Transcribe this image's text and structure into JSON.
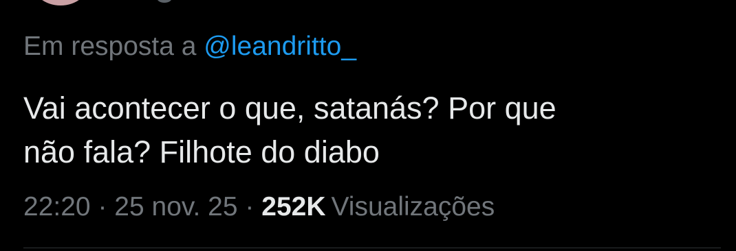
{
  "reply": {
    "prefix": "Em resposta a",
    "handle": "@leandritto_"
  },
  "tweet": {
    "line1": "Vai acontecer o que, satanás? Por que",
    "line2": "não fala? Filhote do diabo"
  },
  "meta": {
    "time": "22:20",
    "separator": "·",
    "date": "25 nov. 25",
    "views_count": "252K",
    "views_label": "Visualizações"
  },
  "colors": {
    "background": "#000000",
    "text_primary": "#e7e9ea",
    "text_secondary": "#71767b",
    "link": "#1d9bf0",
    "divider": "#2f3336"
  }
}
